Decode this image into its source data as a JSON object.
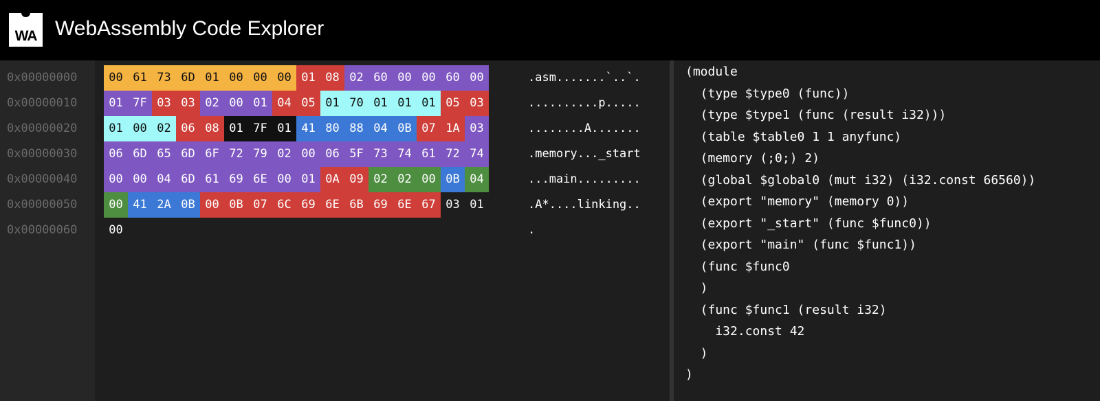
{
  "header": {
    "logo_text": "WA",
    "title": "WebAssembly Code Explorer"
  },
  "colors": {
    "header_bg": "#000000",
    "gutter_bg": "#262626",
    "panel_bg": "#1e1e1e",
    "offset_text": "#6a6a6a",
    "section_orange": "#f5b342",
    "section_red": "#cf3e38",
    "section_purple": "#7e57c2",
    "section_cyan": "#a0f8f8",
    "section_blue": "#3c79d6",
    "section_green": "#4e8e41",
    "section_black": "#111111"
  },
  "hexdump": {
    "rows": [
      {
        "offset": "0x00000000",
        "ascii": ".asm.......`..`.",
        "bytes": [
          {
            "v": "00",
            "c": "orange"
          },
          {
            "v": "61",
            "c": "orange"
          },
          {
            "v": "73",
            "c": "orange"
          },
          {
            "v": "6D",
            "c": "orange"
          },
          {
            "v": "01",
            "c": "orange"
          },
          {
            "v": "00",
            "c": "orange"
          },
          {
            "v": "00",
            "c": "orange"
          },
          {
            "v": "00",
            "c": "orange"
          },
          {
            "v": "01",
            "c": "red"
          },
          {
            "v": "08",
            "c": "red"
          },
          {
            "v": "02",
            "c": "purple"
          },
          {
            "v": "60",
            "c": "purple"
          },
          {
            "v": "00",
            "c": "purple"
          },
          {
            "v": "00",
            "c": "purple"
          },
          {
            "v": "60",
            "c": "purple"
          },
          {
            "v": "00",
            "c": "purple"
          }
        ]
      },
      {
        "offset": "0x00000010",
        "ascii": "..........p.....",
        "bytes": [
          {
            "v": "01",
            "c": "purple"
          },
          {
            "v": "7F",
            "c": "purple"
          },
          {
            "v": "03",
            "c": "red"
          },
          {
            "v": "03",
            "c": "red"
          },
          {
            "v": "02",
            "c": "purple"
          },
          {
            "v": "00",
            "c": "purple"
          },
          {
            "v": "01",
            "c": "purple"
          },
          {
            "v": "04",
            "c": "red"
          },
          {
            "v": "05",
            "c": "red"
          },
          {
            "v": "01",
            "c": "cyan"
          },
          {
            "v": "70",
            "c": "cyan"
          },
          {
            "v": "01",
            "c": "cyan"
          },
          {
            "v": "01",
            "c": "cyan"
          },
          {
            "v": "01",
            "c": "cyan"
          },
          {
            "v": "05",
            "c": "red"
          },
          {
            "v": "03",
            "c": "red"
          }
        ]
      },
      {
        "offset": "0x00000020",
        "ascii": "........A.......",
        "bytes": [
          {
            "v": "01",
            "c": "cyan"
          },
          {
            "v": "00",
            "c": "cyan"
          },
          {
            "v": "02",
            "c": "cyan"
          },
          {
            "v": "06",
            "c": "red"
          },
          {
            "v": "08",
            "c": "red"
          },
          {
            "v": "01",
            "c": "black"
          },
          {
            "v": "7F",
            "c": "black"
          },
          {
            "v": "01",
            "c": "black"
          },
          {
            "v": "41",
            "c": "blue"
          },
          {
            "v": "80",
            "c": "blue"
          },
          {
            "v": "88",
            "c": "blue"
          },
          {
            "v": "04",
            "c": "blue"
          },
          {
            "v": "0B",
            "c": "blue"
          },
          {
            "v": "07",
            "c": "red"
          },
          {
            "v": "1A",
            "c": "red"
          },
          {
            "v": "03",
            "c": "purple"
          }
        ]
      },
      {
        "offset": "0x00000030",
        "ascii": ".memory..._start",
        "bytes": [
          {
            "v": "06",
            "c": "purple"
          },
          {
            "v": "6D",
            "c": "purple"
          },
          {
            "v": "65",
            "c": "purple"
          },
          {
            "v": "6D",
            "c": "purple"
          },
          {
            "v": "6F",
            "c": "purple"
          },
          {
            "v": "72",
            "c": "purple"
          },
          {
            "v": "79",
            "c": "purple"
          },
          {
            "v": "02",
            "c": "purple"
          },
          {
            "v": "00",
            "c": "purple"
          },
          {
            "v": "06",
            "c": "purple"
          },
          {
            "v": "5F",
            "c": "purple"
          },
          {
            "v": "73",
            "c": "purple"
          },
          {
            "v": "74",
            "c": "purple"
          },
          {
            "v": "61",
            "c": "purple"
          },
          {
            "v": "72",
            "c": "purple"
          },
          {
            "v": "74",
            "c": "purple"
          }
        ]
      },
      {
        "offset": "0x00000040",
        "ascii": "...main.........",
        "bytes": [
          {
            "v": "00",
            "c": "purple"
          },
          {
            "v": "00",
            "c": "purple"
          },
          {
            "v": "04",
            "c": "purple"
          },
          {
            "v": "6D",
            "c": "purple"
          },
          {
            "v": "61",
            "c": "purple"
          },
          {
            "v": "69",
            "c": "purple"
          },
          {
            "v": "6E",
            "c": "purple"
          },
          {
            "v": "00",
            "c": "purple"
          },
          {
            "v": "01",
            "c": "purple"
          },
          {
            "v": "0A",
            "c": "red"
          },
          {
            "v": "09",
            "c": "red"
          },
          {
            "v": "02",
            "c": "green"
          },
          {
            "v": "02",
            "c": "green"
          },
          {
            "v": "00",
            "c": "green"
          },
          {
            "v": "0B",
            "c": "blue"
          },
          {
            "v": "04",
            "c": "green"
          }
        ]
      },
      {
        "offset": "0x00000050",
        "ascii": ".A*....linking..",
        "bytes": [
          {
            "v": "00",
            "c": "green"
          },
          {
            "v": "41",
            "c": "blue"
          },
          {
            "v": "2A",
            "c": "blue"
          },
          {
            "v": "0B",
            "c": "blue"
          },
          {
            "v": "00",
            "c": "red"
          },
          {
            "v": "0B",
            "c": "red"
          },
          {
            "v": "07",
            "c": "red"
          },
          {
            "v": "6C",
            "c": "red"
          },
          {
            "v": "69",
            "c": "red"
          },
          {
            "v": "6E",
            "c": "red"
          },
          {
            "v": "6B",
            "c": "red"
          },
          {
            "v": "69",
            "c": "red"
          },
          {
            "v": "6E",
            "c": "red"
          },
          {
            "v": "67",
            "c": "red"
          },
          {
            "v": "03",
            "c": "none"
          },
          {
            "v": "01",
            "c": "none"
          }
        ]
      },
      {
        "offset": "0x00000060",
        "ascii": ".",
        "bytes": [
          {
            "v": "00",
            "c": "none"
          }
        ]
      }
    ]
  },
  "wat": {
    "lines": [
      "(module",
      "  (type $type0 (func))",
      "  (type $type1 (func (result i32)))",
      "  (table $table0 1 1 anyfunc)",
      "  (memory (;0;) 2)",
      "  (global $global0 (mut i32) (i32.const 66560))",
      "  (export \"memory\" (memory 0))",
      "  (export \"_start\" (func $func0))",
      "  (export \"main\" (func $func1))",
      "  (func $func0",
      "  )",
      "  (func $func1 (result i32)",
      "    i32.const 42",
      "  )",
      ")"
    ]
  }
}
